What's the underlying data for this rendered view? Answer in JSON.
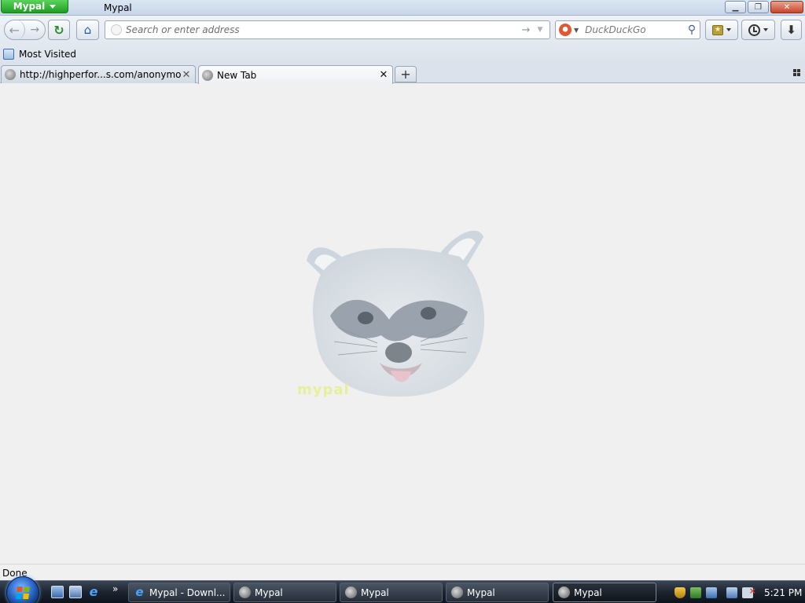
{
  "window": {
    "app_menu_label": "Mypal",
    "title": "Mypal",
    "controls": [
      "minimize",
      "restore",
      "close"
    ]
  },
  "navbar": {
    "url_placeholder": "Search or enter address",
    "search_engine": "DuckDuckGo",
    "search_placeholder": "DuckDuckGo"
  },
  "bookmarks_toolbar": {
    "items": [
      {
        "label": "Most Visited"
      }
    ]
  },
  "tabs": [
    {
      "label": "http://highperfor...s.com/anonymous/",
      "active": false
    },
    {
      "label": "New Tab",
      "active": true
    }
  ],
  "content": {
    "watermark": "mypal"
  },
  "statusbar": {
    "text": "Done"
  },
  "taskbar": {
    "buttons": [
      {
        "label": "Mypal - Downl...",
        "icon": "ie-icon",
        "active": false
      },
      {
        "label": "Mypal",
        "icon": "mypal-icon",
        "active": false
      },
      {
        "label": "Mypal",
        "icon": "mypal-icon",
        "active": false
      },
      {
        "label": "Mypal",
        "icon": "mypal-icon",
        "active": false
      },
      {
        "label": "Mypal",
        "icon": "mypal-icon",
        "active": true
      }
    ],
    "clock": "5:21 PM"
  },
  "colors": {
    "app_menu": "#1f9e22",
    "taskbar": "#1c2430",
    "content_bg": "#f0f0f0"
  }
}
